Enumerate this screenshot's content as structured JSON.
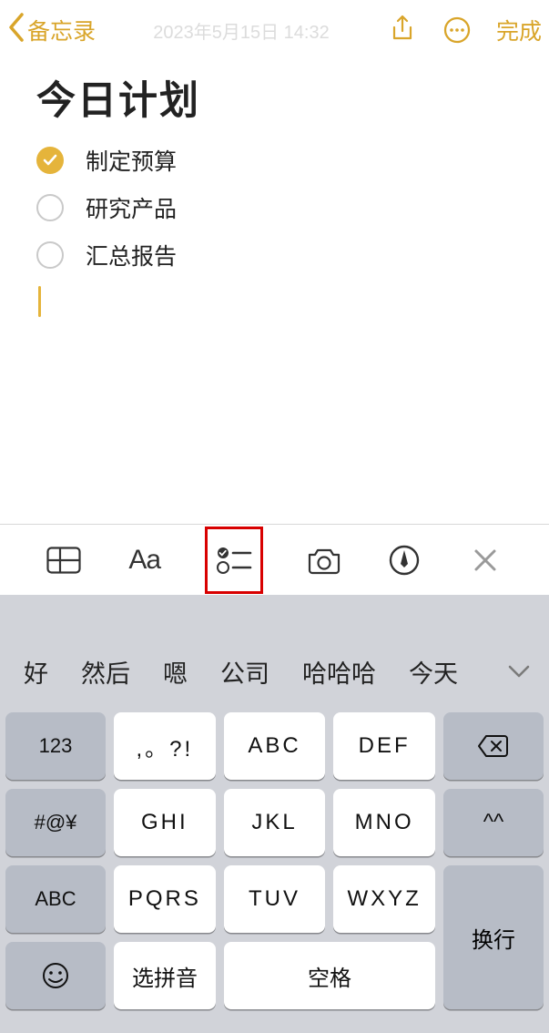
{
  "nav": {
    "back_label": "备忘录",
    "timestamp": "2023年5月15日 14:32",
    "done_label": "完成"
  },
  "note": {
    "title": "今日计划",
    "items": [
      {
        "text": "制定预算",
        "checked": true
      },
      {
        "text": "研究产品",
        "checked": false
      },
      {
        "text": "汇总报告",
        "checked": false
      }
    ]
  },
  "toolbar": {
    "aa_label": "Aa"
  },
  "suggestions": {
    "items": [
      "好",
      "然后",
      "嗯",
      "公司",
      "哈哈哈",
      "今天"
    ]
  },
  "keyboard": {
    "row1": {
      "k0": "123",
      "k1": ",。?!",
      "k2": "ABC",
      "k3": "DEF"
    },
    "row2": {
      "k0": "#@¥",
      "k1": "GHI",
      "k2": "JKL",
      "k3": "MNO",
      "face": "^^"
    },
    "row3": {
      "k0": "ABC",
      "k1": "PQRS",
      "k2": "TUV",
      "k3": "WXYZ"
    },
    "row4": {
      "pinyin": "选拼音",
      "space": "空格",
      "enter": "换行"
    }
  }
}
